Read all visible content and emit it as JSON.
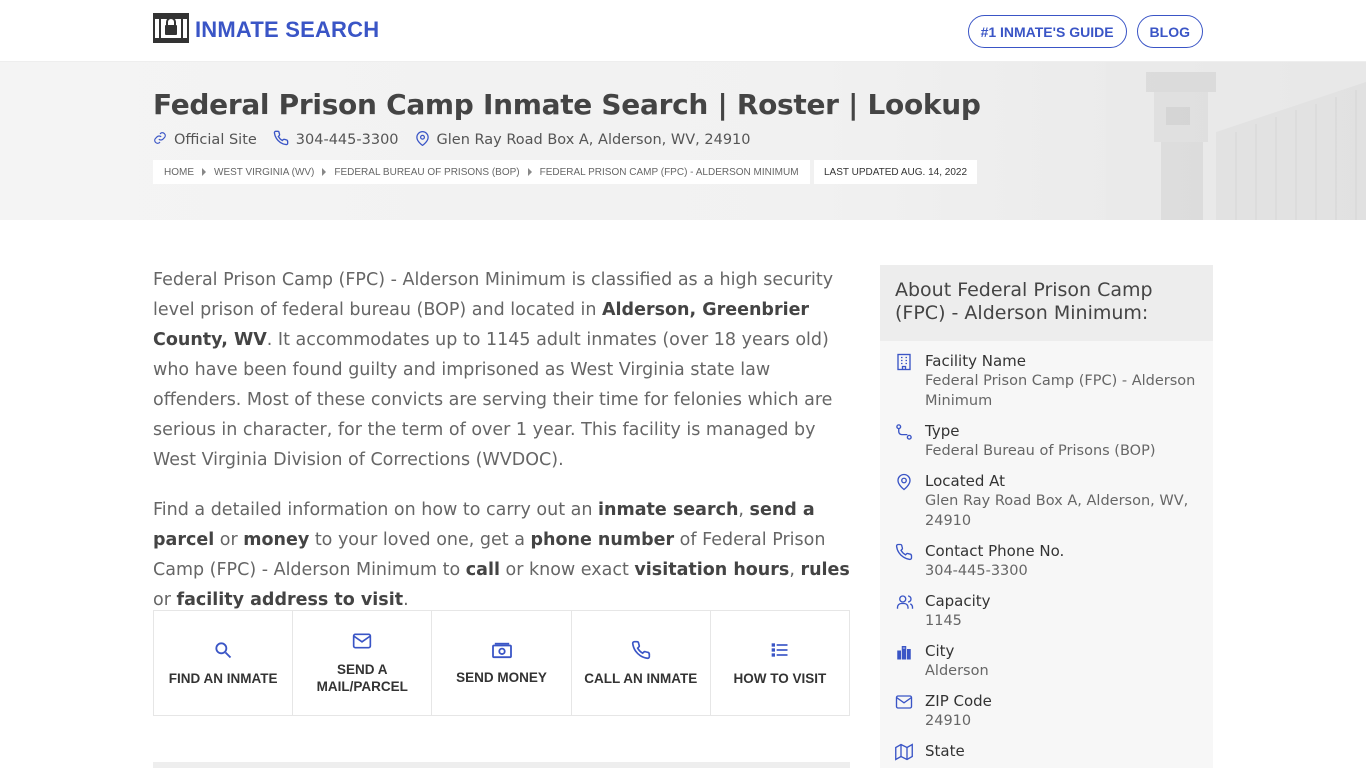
{
  "header": {
    "logo_text": "INMATE SEARCH",
    "nav": {
      "guide": "#1 INMATE'S GUIDE",
      "blog": "BLOG"
    }
  },
  "hero": {
    "title": "Federal Prison Camp Inmate Search | Roster | Lookup",
    "official_site": "Official Site",
    "phone": "304-445-3300",
    "address": "Glen Ray Road Box A, Alderson, WV, 24910",
    "breadcrumb": [
      "HOME",
      "WEST VIRGINIA (WV)",
      "FEDERAL BUREAU OF PRISONS (BOP)",
      "FEDERAL PRISON CAMP (FPC) - ALDERSON MINIMUM"
    ],
    "last_updated": "LAST UPDATED AUG. 14, 2022"
  },
  "content": {
    "p1": {
      "a": "Federal Prison Camp (FPC) - Alderson Minimum is classified as a high security level prison of federal bureau (BOP) and located in ",
      "b": "Alderson, Greenbrier County, WV",
      "c": ". It accommodates up to 1145 adult inmates (over 18 years old) who have been found guilty and imprisoned as West Virginia state law offenders. Most of these convicts are serving their time for felonies which are serious in character, for the term of over 1 year. This facility is managed by West Virginia Division of Corrections (WVDOC)."
    },
    "p2": {
      "t1": "Find a detailed information on how to carry out an ",
      "b1": "inmate search",
      "t2": ", ",
      "b2": "send a parcel",
      "t3": " or ",
      "b3": "money",
      "t4": " to your loved one, get a ",
      "b4": "phone number",
      "t5": " of Federal Prison Camp (FPC) - Alderson Minimum to ",
      "b5": "call",
      "t6": " or know exact ",
      "b6": "visitation hours",
      "t7": ", ",
      "b7": "rules",
      "t8": " or ",
      "b8": "facility address to visit",
      "t9": "."
    }
  },
  "actions": [
    {
      "label": "FIND AN INMATE",
      "icon": "search-icon"
    },
    {
      "label": "SEND A MAIL/PARCEL",
      "icon": "mail-icon"
    },
    {
      "label": "SEND MONEY",
      "icon": "money-icon"
    },
    {
      "label": "CALL AN INMATE",
      "icon": "phone-icon"
    },
    {
      "label": "HOW TO VISIT",
      "icon": "list-icon"
    }
  ],
  "sidebar": {
    "title": "About Federal Prison Camp (FPC) - Alderson Minimum:",
    "items": [
      {
        "label": "Facility Name",
        "value": "Federal Prison Camp (FPC) - Alderson Minimum",
        "icon": "building-icon"
      },
      {
        "label": "Type",
        "value": "Federal Bureau of Prisons (BOP)",
        "icon": "route-icon"
      },
      {
        "label": "Located At",
        "value": "Glen Ray Road Box A, Alderson, WV, 24910",
        "icon": "location-pin-icon"
      },
      {
        "label": "Contact Phone No.",
        "value": "304-445-3300",
        "icon": "phone-icon"
      },
      {
        "label": "Capacity",
        "value": "1145",
        "icon": "users-icon"
      },
      {
        "label": "City",
        "value": "Alderson",
        "icon": "city-icon"
      },
      {
        "label": "ZIP Code",
        "value": "24910",
        "icon": "mail-icon"
      },
      {
        "label": "State",
        "value": "",
        "icon": "map-icon"
      }
    ]
  },
  "colors": {
    "accent": "#3a55c6",
    "text": "#555555",
    "hero_bg": "#f2f2f2"
  }
}
